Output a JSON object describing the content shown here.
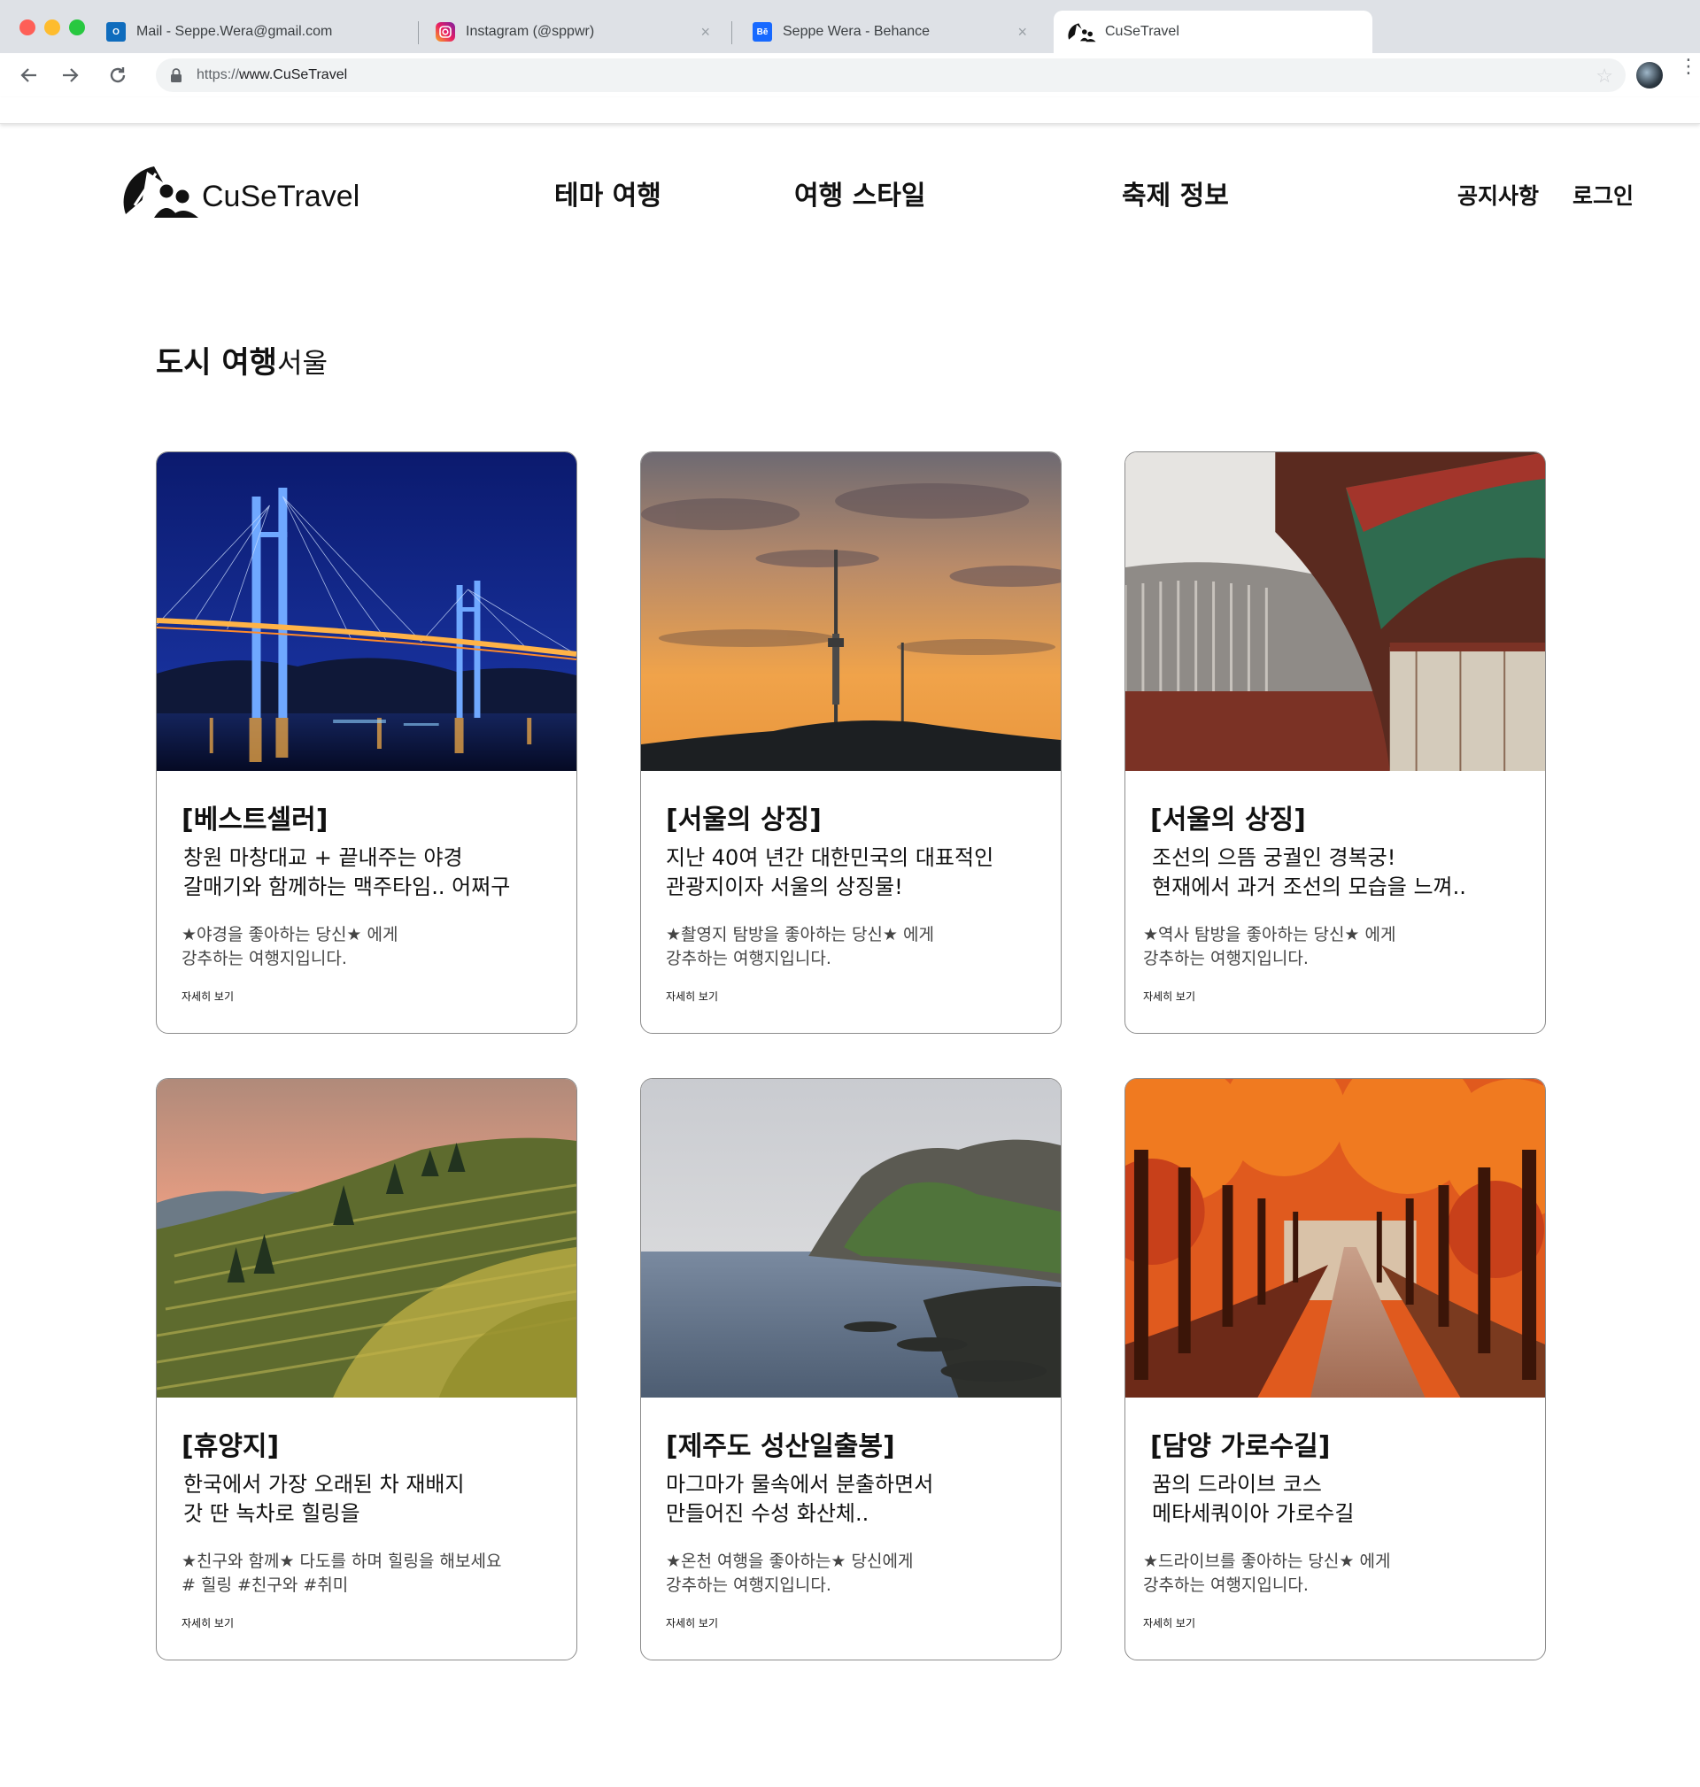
{
  "browser": {
    "tabs": [
      {
        "title": "Mail - Seppe.Wera@gmail.com",
        "icon": "outlook-icon"
      },
      {
        "title": "Instagram (@sppwr)",
        "icon": "instagram-icon"
      },
      {
        "title": "Seppe Wera - Behance",
        "icon": "behance-icon"
      },
      {
        "title": "CuSeTravel",
        "icon": "cusetravel-logo-icon"
      }
    ],
    "active_tab": 3,
    "url_scheme": "https://",
    "url_host": "www.CuSeTravel"
  },
  "site": {
    "logo_text": "CuSeTravel",
    "nav": [
      "테마 여행",
      "여행 스타일",
      "축제 정보"
    ],
    "notice": "공지사항",
    "login": "로그인"
  },
  "section": {
    "title": "도시 여행",
    "subtitle": "서울"
  },
  "cards": [
    {
      "image": "bridge-night",
      "tag": "[베스트셀러]",
      "desc_line1": "창원 마창대교 + 끝내주는 야경",
      "desc_line2": "갈매기와 함께하는 맥주타임.. 어쩌구",
      "note_line1": "★야경을 좋아하는 당신★ 에게",
      "note_line2": "강추하는 여행지입니다.",
      "more": "자세히 보기"
    },
    {
      "image": "namsan-tower",
      "tag": "[서울의 상징]",
      "desc_line1": "지난 40여 년간 대한민국의 대표적인",
      "desc_line2": "관광지이자 서울의 상징물!",
      "note_line1": "★촬영지 탐방을 좋아하는 당신★ 에게",
      "note_line2": "강추하는 여행지입니다.",
      "more": "자세히 보기"
    },
    {
      "image": "palace-roof",
      "tag": "[서울의 상징]",
      "desc_line1": "조선의 으뜸 궁궐인 경복궁!",
      "desc_line2": "현재에서 과거 조선의 모습을 느껴..",
      "note_line1": "★역사 탐방을 좋아하는 당신★ 에게",
      "note_line2": "강추하는 여행지입니다.",
      "more": "자세히 보기"
    },
    {
      "image": "tea-fields",
      "tag": "[휴양지]",
      "desc_line1": "한국에서 가장 오래된 차 재배지",
      "desc_line2": "갓 딴 녹차로 힐링을",
      "note_line1": "★친구와 함께★ 다도를 하며 힐링을 해보세요",
      "note_line2": "# 힐링 #친구와 #취미",
      "more": "자세히 보기"
    },
    {
      "image": "seongsan-coast",
      "tag": "[제주도 성산일출봉]",
      "desc_line1": "마그마가 물속에서 분출하면서",
      "desc_line2": "만들어진 수성 화산체..",
      "note_line1": "★온천 여행을 좋아하는★ 당신에게",
      "note_line2": "강추하는 여행지입니다.",
      "more": "자세히 보기"
    },
    {
      "image": "autumn-trees-road",
      "tag": "[담양 가로수길]",
      "desc_line1": "꿈의 드라이브 코스",
      "desc_line2": "메타세쿼이아 가로수길",
      "note_line1": "★드라이브를 좋아하는 당신★ 에게",
      "note_line2": "강추하는 여행지입니다.",
      "more": "자세히 보기"
    }
  ]
}
